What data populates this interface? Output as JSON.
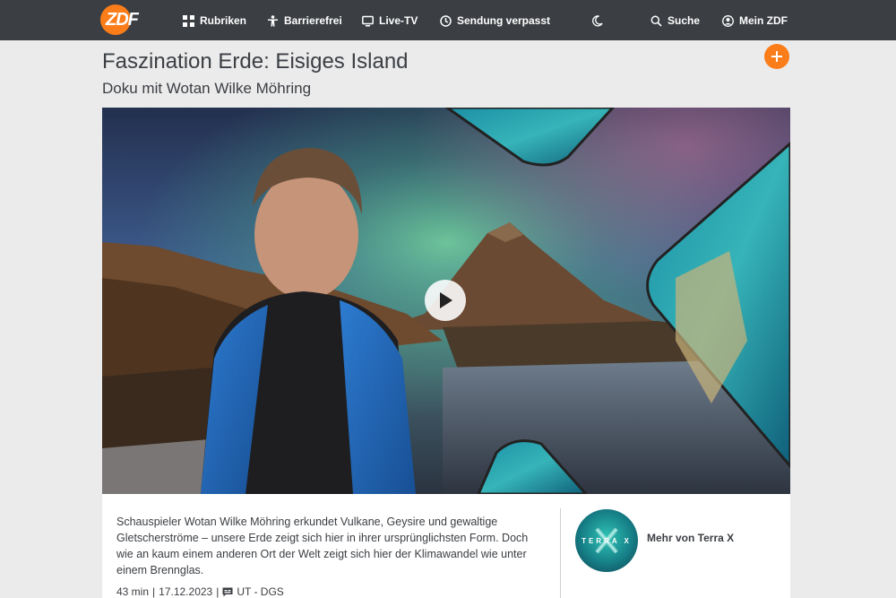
{
  "nav": {
    "logo_text": "ZDF",
    "items": [
      {
        "label": "Rubriken",
        "icon": "grid-icon"
      },
      {
        "label": "Barrierefrei",
        "icon": "accessibility-icon"
      },
      {
        "label": "Live-TV",
        "icon": "tv-icon"
      },
      {
        "label": "Sendung verpasst",
        "icon": "clock-icon"
      }
    ],
    "theme_icon": "moon-icon",
    "search_label": "Suche",
    "account_label": "Mein ZDF"
  },
  "header": {
    "title": "Faszination Erde: Eisiges Island",
    "subtitle": "Doku mit Wotan Wilke Möhring"
  },
  "info": {
    "description": "Schauspieler Wotan Wilke Möhring erkundet Vulkane, Geysire und gewaltige Gletscherströme – unsere Erde zeigt sich hier in ihrer ursprünglichsten Form. Doch wie an kaum einem anderen Ort der Welt zeigt sich hier der Klimawandel wie unter einem Brennglas.",
    "duration": "43 min",
    "date": "17.12.2023",
    "accessibility": "UT - DGS",
    "brand_logo_text": "TERRA X",
    "brand_link": "Mehr von Terra X"
  },
  "colors": {
    "accent": "#fa7d19",
    "nav_bg": "#3b3e43",
    "page_bg": "#ebebeb"
  }
}
